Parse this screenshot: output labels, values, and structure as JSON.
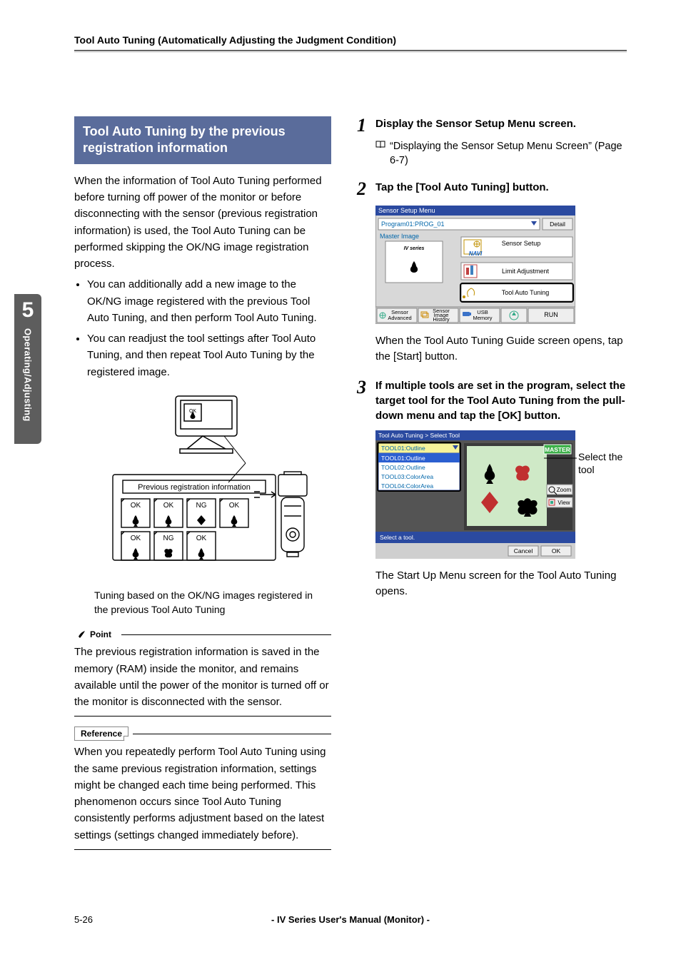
{
  "running_head": "Tool Auto Tuning (Automatically Adjusting the Judgment Condition)",
  "side_tab": {
    "chapter": "5",
    "label": "Operating/Adjusting"
  },
  "left": {
    "subhead": "Tool Auto Tuning by the previous registration information",
    "intro": "When the information of Tool Auto Tuning performed before turning off power of the monitor or before disconnecting with the sensor (previous registration information) is used, the Tool Auto Tuning can be performed skipping the OK/NG image registration process.",
    "bullets": [
      "You can additionally add a new image to the OK/NG image registered with the previous Tool Auto Tuning, and then perform Tool Auto Tuning.",
      "You can readjust the tool settings after Tool Auto Tuning, and then repeat Tool Auto Tuning by the registered image."
    ],
    "diagram": {
      "box_label": "Previous registration information",
      "thumbs": [
        {
          "tag": "OK",
          "suit": "spade"
        },
        {
          "tag": "OK",
          "suit": "spade"
        },
        {
          "tag": "NG",
          "suit": "diamond"
        },
        {
          "tag": "OK",
          "suit": "spade"
        },
        {
          "tag": "OK",
          "suit": "spade"
        },
        {
          "tag": "NG",
          "suit": "heart"
        },
        {
          "tag": "OK",
          "suit": "spade"
        }
      ],
      "caption": "Tuning based on the OK/NG images registered in the previous Tool Auto Tuning"
    },
    "point_label": "Point",
    "point_text": "The previous registration information is saved in the memory (RAM) inside the monitor, and remains available until the power of the monitor is turned off or the monitor is disconnected with the sensor.",
    "ref_label": "Reference",
    "ref_text": "When you repeatedly perform Tool Auto Tuning using the same previous registration information, settings might be changed each time being performed. This phenomenon occurs since Tool Auto Tuning consistently performs adjustment based on the latest settings (settings changed immediately before)."
  },
  "right": {
    "steps": [
      {
        "n": "1",
        "title": "Display the Sensor Setup Menu screen.",
        "xref": "“Displaying the Sensor Setup Menu Screen” (Page 6-7)"
      },
      {
        "n": "2",
        "title": "Tap the [Tool Auto Tuning] button.",
        "shot": {
          "title": "Sensor Setup Menu",
          "program": "Program01:PROG_01",
          "detail": "Detail",
          "master": "Master Image",
          "master_sub": "IV series",
          "btn_sensor": "Sensor Setup",
          "navi": "NAVI",
          "btn_limit": "Limit Adjustment",
          "btn_tune": "Tool Auto Tuning",
          "bb1": "Sensor Advanced",
          "bb2": "Sensor Image History",
          "bb3": "USB Memory",
          "bb4": "RUN"
        },
        "after": "When the Tool Auto Tuning Guide screen opens, tap the [Start] button."
      },
      {
        "n": "3",
        "title": "If multiple tools are set in the program, select the target tool for the Tool Auto Tuning from the pull-down menu and tap the [OK] button.",
        "shot2": {
          "bc": "Tool Auto Tuning > Select Tool",
          "sel": "TOOL01:Outline",
          "opts": [
            "TOOL01:Outline",
            "TOOL02:Outline",
            "TOOL03:ColorArea",
            "TOOL04:ColorArea"
          ],
          "master_badge": "MASTER",
          "zoom": "Zoom",
          "view": "View",
          "hint": "Select a tool.",
          "cancel": "Cancel",
          "ok": "OK",
          "annot": "Select the tool"
        },
        "after": "The Start Up Menu screen for the Tool Auto Tuning opens."
      }
    ]
  },
  "footer": {
    "page": "5-26",
    "title": "- IV Series User's Manual (Monitor) -"
  }
}
